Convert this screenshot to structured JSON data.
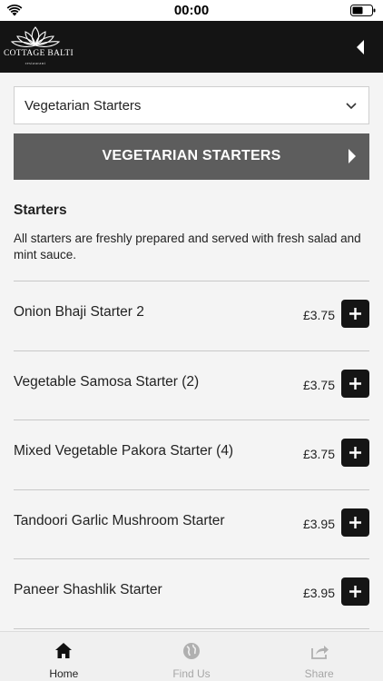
{
  "status_bar": {
    "time": "00:00"
  },
  "header": {
    "brand_name": "COTTAGE BALTI",
    "brand_sub": "restaurant"
  },
  "category_select": {
    "value": "Vegetarian Starters"
  },
  "category_banner": {
    "label": "VEGETARIAN STARTERS"
  },
  "section": {
    "title": "Starters",
    "description": "All starters are freshly prepared and served with fresh salad and mint sauce."
  },
  "menu_items": [
    {
      "name": "Onion Bhaji Starter 2",
      "price": "£3.75"
    },
    {
      "name": "Vegetable Samosa Starter (2)",
      "price": "£3.75"
    },
    {
      "name": "Mixed Vegetable Pakora Starter (4)",
      "price": "£3.75"
    },
    {
      "name": "Tandoori Garlic Mushroom Starter",
      "price": "£3.95"
    },
    {
      "name": "Paneer Shashlik Starter",
      "price": "£3.95"
    }
  ],
  "tabs": [
    {
      "label": "Home",
      "icon": "home-icon",
      "active": true
    },
    {
      "label": "Find Us",
      "icon": "globe-icon",
      "active": false
    },
    {
      "label": "Share",
      "icon": "share-icon",
      "active": false
    }
  ],
  "colors": {
    "header_bg": "#141414",
    "banner_bg": "#5d5d5d",
    "add_button_bg": "#151515",
    "background": "#f4f4f4",
    "tab_inactive": "#a6a6a6"
  }
}
